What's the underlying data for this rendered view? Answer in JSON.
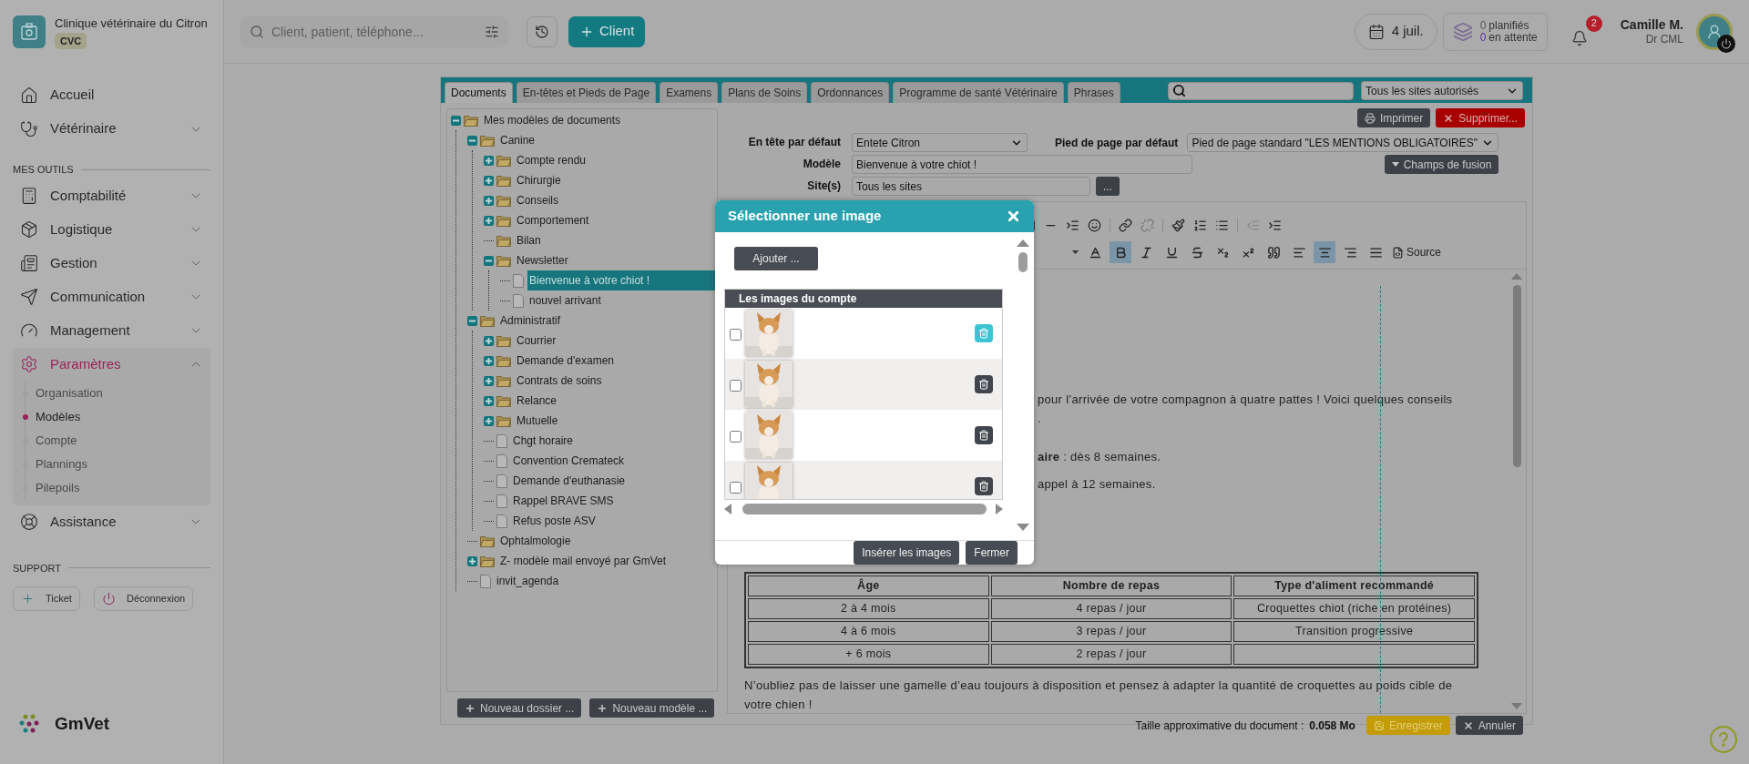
{
  "sidebar": {
    "clinic": {
      "name": "Clinique vétérinaire du Citron",
      "code": "CVC"
    },
    "groups": [
      {
        "items": [
          {
            "label": "Accueil",
            "selected": false
          },
          {
            "label": "Vétérinaire",
            "selected": false,
            "expanded": false
          }
        ]
      },
      {
        "heading": "MES OUTILS",
        "items": [
          {
            "label": "Comptabilité",
            "selected": false,
            "expanded": false
          },
          {
            "label": "Logistique",
            "selected": false,
            "expanded": false
          },
          {
            "label": "Gestion",
            "selected": false,
            "expanded": false
          },
          {
            "label": "Communication",
            "selected": false,
            "expanded": false
          },
          {
            "label": "Management",
            "selected": false,
            "expanded": false
          },
          {
            "label": "Paramètres",
            "selected": true,
            "expanded": true,
            "children": [
              {
                "label": "Organisation",
                "selected": false
              },
              {
                "label": "Modèles",
                "selected": true
              },
              {
                "label": "Compte",
                "selected": false
              },
              {
                "label": "Plannings",
                "selected": false
              },
              {
                "label": "Pilepoils",
                "selected": false
              }
            ]
          },
          {
            "label": "Assistance",
            "selected": false,
            "expanded": false
          }
        ]
      }
    ],
    "support": {
      "heading": "SUPPORT",
      "buttons": [
        "Ticket",
        "Déconnexion"
      ]
    },
    "brand": "GmVet"
  },
  "topbar": {
    "search": {
      "placeholder": "Client, patient, téléphone..."
    },
    "new_client_button": "Client",
    "date": "4 juil.",
    "planned": {
      "count": "0",
      "label": "planifiés"
    },
    "pending": {
      "count": "0",
      "label": "en attente"
    },
    "notifications": "2",
    "user": {
      "name": "Camille M.",
      "role": "Dr CML"
    }
  },
  "documents": {
    "tabs": [
      {
        "label": "Documents",
        "selected": true
      },
      {
        "label": "En-têtes et Pieds de Page",
        "selected": false
      },
      {
        "label": "Examens",
        "selected": false
      },
      {
        "label": "Plans de Soins",
        "selected": false
      },
      {
        "label": "Ordonnances",
        "selected": false
      },
      {
        "label": "Programme de santé Vétérinaire",
        "selected": false
      },
      {
        "label": "Phrases",
        "selected": false
      }
    ],
    "site_filter": "Tous les sites autorisés",
    "tree": [
      {
        "kind": "folder",
        "label": "Mes modèles de documents",
        "selected": false,
        "expanded": true,
        "children": [
          {
            "kind": "folder",
            "label": "Canine",
            "selected": false,
            "expanded": true,
            "children": [
              {
                "kind": "folder",
                "label": "Compte rendu",
                "selected": false,
                "expanded": false
              },
              {
                "kind": "folder",
                "label": "Chirurgie",
                "selected": false,
                "expanded": false
              },
              {
                "kind": "folder",
                "label": "Conseils",
                "selected": false,
                "expanded": false
              },
              {
                "kind": "folder",
                "label": "Comportement",
                "selected": false,
                "expanded": false
              },
              {
                "kind": "folder",
                "label": "Bilan",
                "selected": false
              },
              {
                "kind": "folder",
                "label": "Newsletter",
                "selected": false,
                "expanded": true,
                "children": [
                  {
                    "kind": "document",
                    "label": "Bienvenue à votre chiot !",
                    "selected": true
                  },
                  {
                    "kind": "document",
                    "label": "nouvel arrivant",
                    "selected": false
                  }
                ]
              }
            ]
          },
          {
            "kind": "folder",
            "label": "Administratif",
            "selected": false,
            "expanded": true,
            "children": [
              {
                "kind": "folder",
                "label": "Courrier",
                "selected": false,
                "expanded": false
              },
              {
                "kind": "folder",
                "label": "Demande d'examen",
                "selected": false,
                "expanded": false
              },
              {
                "kind": "folder",
                "label": "Contrats de soins",
                "selected": false,
                "expanded": false
              },
              {
                "kind": "folder",
                "label": "Relance",
                "selected": false,
                "expanded": false
              },
              {
                "kind": "folder",
                "label": "Mutuelle",
                "selected": false,
                "expanded": false
              },
              {
                "kind": "document",
                "label": "Chgt horaire",
                "selected": false
              },
              {
                "kind": "document",
                "label": "Convention Cremateck",
                "selected": false
              },
              {
                "kind": "document",
                "label": "Demande d'euthanasie",
                "selected": false
              },
              {
                "kind": "document",
                "label": "Rappel BRAVE SMS",
                "selected": false
              },
              {
                "kind": "document",
                "label": "Refus poste ASV",
                "selected": false
              }
            ]
          },
          {
            "kind": "folder",
            "label": "Ophtalmologie",
            "selected": false
          },
          {
            "kind": "folder",
            "label": "Z- modèle mail envoyé par GmVet",
            "selected": false,
            "expanded": false
          },
          {
            "kind": "document",
            "label": "invit_agenda",
            "selected": false
          }
        ]
      }
    ],
    "tree_buttons": [
      "Nouveau dossier ...",
      "Nouveau modèle ..."
    ],
    "editor": {
      "print_button": "Imprimer",
      "delete_button": "Supprimer...",
      "header": {
        "label": "En tête par défaut",
        "value": "Entete Citron"
      },
      "footer": {
        "label": "Pied de page par défaut",
        "value": "Pied de page standard \"LES MENTIONS OBLIGATOIRES\""
      },
      "model": {
        "label": "Modèle",
        "value": "Bienvenue à votre chiot !"
      },
      "sites": {
        "label": "Site(s)",
        "value": "Tous les sites",
        "button": "..."
      },
      "merge_fields_button": "Champs de fusion",
      "format_toolbar": [
        {
          "kind": "dropdown",
          "active": false
        },
        {
          "kind": "font-color",
          "active": false
        },
        {
          "kind": "bold",
          "active": true
        },
        {
          "kind": "italic",
          "active": false
        },
        {
          "kind": "underline",
          "active": false
        },
        {
          "kind": "strike",
          "active": false
        },
        {
          "kind": "subscript",
          "active": false
        },
        {
          "kind": "superscript",
          "active": false
        },
        {
          "kind": "quote",
          "active": false
        },
        {
          "kind": "align-left",
          "active": false
        },
        {
          "kind": "align-center",
          "active": true
        },
        {
          "kind": "align-right",
          "active": false
        },
        {
          "kind": "justify",
          "active": false
        },
        {
          "kind": "source",
          "label": "Source",
          "active": false
        }
      ],
      "content": {
        "fragments": [
          "pour l’arrivée de votre compagnon à quatre pattes ! Voici quelques conseils",
          ".",
          "**aire** : dès 8 semaines.",
          "appel à 12 semaines."
        ],
        "table": {
          "columns": [
            "Âge",
            "Nombre de repas",
            "Type d'aliment recommandé"
          ],
          "rows": [
            [
              "2 à 4 mois",
              "4 repas / jour",
              "Croquettes chiot (riche en protéines)"
            ],
            [
              "4 à 6 mois",
              "3 repas / jour",
              "Transition progressive"
            ],
            [
              "+ 6 mois",
              "2 repas / jour",
              ""
            ]
          ]
        },
        "closing": "N’oubliez pas de laisser une gamelle d’eau toujours à disposition et pensez à adapter la quantité de croquettes au poids cible de votre chien !"
      }
    },
    "size_label": "Taille approximative du document :",
    "size_value": "0.058 Mo",
    "save_button": "Enregistrer",
    "cancel_button": "Annuler"
  },
  "modal": {
    "title": "Sélectionner une image",
    "add_button": "Ajouter ...",
    "list_heading": "Les images du compte",
    "images": [
      {
        "kind": "picture",
        "checked": false,
        "highlighted": true
      },
      {
        "kind": "picture",
        "checked": false,
        "highlighted": false
      },
      {
        "kind": "picture",
        "checked": false,
        "highlighted": false
      },
      {
        "kind": "picture",
        "checked": false,
        "highlighted": false
      }
    ],
    "buttons": [
      "Insérer les images",
      "Fermer"
    ]
  }
}
